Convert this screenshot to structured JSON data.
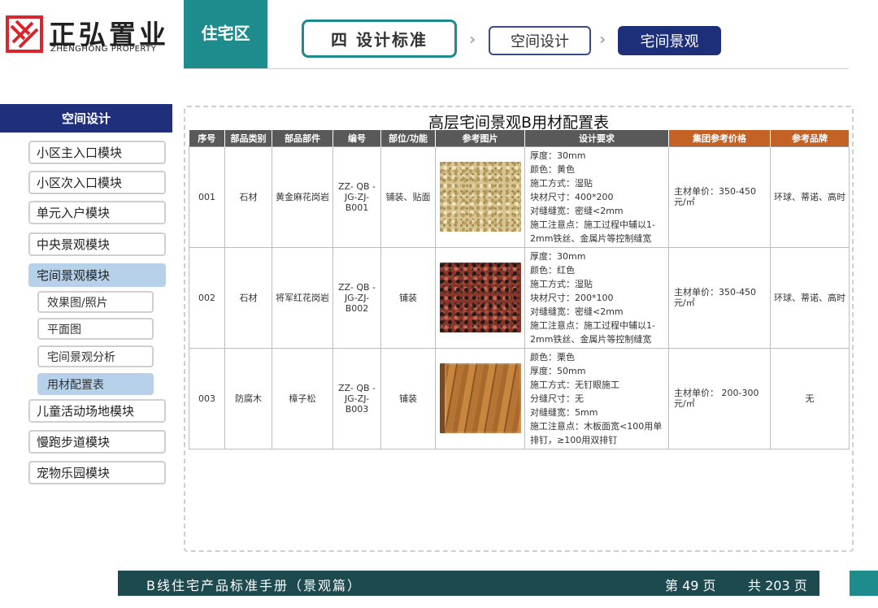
{
  "logo": {
    "name_cn": "正弘置业",
    "name_en": "ZHENGHONG PROPERTY",
    "brand_color": "#d9262c"
  },
  "header": {
    "section": "住宅区",
    "breadcrumb": [
      "四  设计标准",
      "空间设计",
      "宅间景观"
    ],
    "accent_teal": "#1e8c8c",
    "accent_navy": "#1e2f7a"
  },
  "sidebar": {
    "title": "空间设计",
    "items": [
      {
        "label": "小区主入口模块"
      },
      {
        "label": "小区次入口模块"
      },
      {
        "label": "单元入户模块"
      },
      {
        "label": "中央景观模块"
      },
      {
        "label": "宅间景观模块",
        "active": true
      },
      {
        "label": "儿童活动场地模块"
      },
      {
        "label": "慢跑步道模块"
      },
      {
        "label": "宠物乐园模块"
      }
    ],
    "sub_items": [
      {
        "label": "效果图/照片"
      },
      {
        "label": "平面图"
      },
      {
        "label": "宅间景观分析"
      },
      {
        "label": "用材配置表",
        "active": true
      }
    ]
  },
  "table": {
    "title": "高层宅间景观B用材配置表",
    "headers": [
      "序号",
      "部品类别",
      "部品部件",
      "编号",
      "部位/功能",
      "参考图片",
      "设计要求",
      "集团参考价格",
      "参考品牌"
    ],
    "rows": [
      {
        "no": "001",
        "category": "石材",
        "part": "黄金麻花岗岩",
        "code": "ZZ- QB - JG-ZJ-B001",
        "function": "铺装、贴面",
        "image": "granite-yellow",
        "requirements": [
          "厚度：30mm",
          "颜色：黄色",
          "施工方式：湿贴",
          "块材尺寸：400*200",
          "对缝缝宽：密缝<2mm",
          "施工注意点：施工过程中辅以1-2mm铁丝、金属片等控制缝宽"
        ],
        "price": "主材单价：350-450元/㎡",
        "brand": "环球、蒂诺、高时"
      },
      {
        "no": "002",
        "category": "石材",
        "part": "将军红花岗岩",
        "code": "ZZ- QB - JG-ZJ-B002",
        "function": "铺装",
        "image": "granite-red",
        "requirements": [
          "厚度：30mm",
          "颜色：红色",
          "施工方式：湿贴",
          "块材尺寸：200*100",
          "对缝缝宽：密缝<2mm",
          "施工注意点：施工过程中辅以1-2mm铁丝、金属片等控制缝宽"
        ],
        "price": "主材单价：350-450元/㎡",
        "brand": "环球、蒂诺、高时"
      },
      {
        "no": "003",
        "category": "防腐木",
        "part": "樟子松",
        "code": "ZZ- QB - JG-ZJ-B003",
        "function": "铺装",
        "image": "wood",
        "requirements": [
          "颜色：栗色",
          "厚度：50mm",
          "施工方式：无钉眼施工",
          "分缝尺寸：无",
          "对缝缝宽：5mm",
          "施工注意点：木板面宽<100用单排钉，≥100用双排钉"
        ],
        "price": "主材单价： 200-300元/㎡",
        "brand": "无"
      }
    ]
  },
  "footer": {
    "title": "B线住宅产品标准手册（景观篇）",
    "page": "第 49 页",
    "total": "共 203 页"
  }
}
